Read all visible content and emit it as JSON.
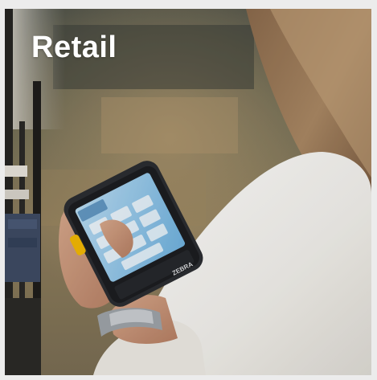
{
  "card": {
    "title": "Retail"
  },
  "photo": {
    "device_brand": "ZEBRA"
  },
  "colors": {
    "title_text": "#ffffff",
    "sweater": "#f3f1ec",
    "device_body": "#2b2d31",
    "device_screen": "#8ec3e6",
    "device_trigger": "#f2b705"
  }
}
